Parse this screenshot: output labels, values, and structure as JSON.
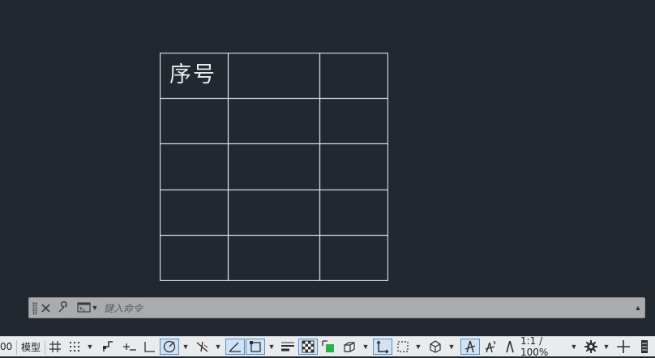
{
  "drawing": {
    "table": {
      "header_cell_text": "序号"
    }
  },
  "command_line": {
    "placeholder": "键入命令"
  },
  "status_bar": {
    "left_clip_text": "00",
    "model_tab_label": "模型",
    "scale_label": "1:1 / 100%"
  },
  "colors": {
    "canvas_background": "#212830",
    "table_lines": "#d8dadd",
    "command_bar": "#a9abae",
    "status_bar": "#e9ebed",
    "active_toggle": "#cfe3f5"
  }
}
